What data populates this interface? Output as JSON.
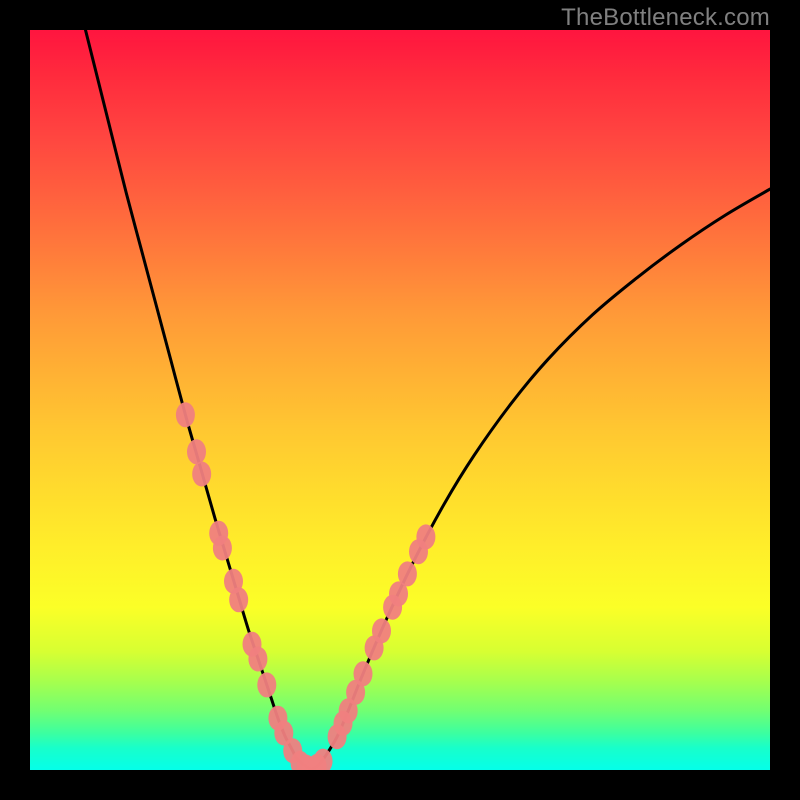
{
  "watermark": "TheBottleneck.com",
  "chart_data": {
    "type": "line",
    "title": "",
    "xlabel": "",
    "ylabel": "",
    "xlim": [
      0,
      100
    ],
    "ylim": [
      0,
      100
    ],
    "grid": false,
    "legend": false,
    "background": {
      "type": "vertical-gradient",
      "top": "#ff153f",
      "bottom": "#05ffe9",
      "note": "red-orange-yellow-green-cyan gradient"
    },
    "series": [
      {
        "name": "bottleneck-curve",
        "stroke": "#000000",
        "stroke_width": 3,
        "x": [
          7.5,
          9,
          11,
          13,
          15,
          17,
          19,
          21,
          23,
          25,
          26.5,
          28,
          29.5,
          31,
          32.5,
          33.5,
          34.5,
          35.5,
          36,
          37,
          38,
          39,
          40,
          41.5,
          43,
          45,
          48,
          52,
          56,
          60,
          65,
          70,
          76,
          82,
          88,
          94,
          100
        ],
        "y": [
          100,
          94,
          86,
          78,
          70.5,
          63,
          55.5,
          48,
          41,
          34,
          29,
          24,
          19,
          14.5,
          10,
          7,
          4.5,
          2.6,
          1.6,
          0.7,
          0.15,
          0.7,
          2,
          4.5,
          8,
          13,
          20,
          28.5,
          36,
          42.5,
          49.5,
          55.5,
          61.5,
          66.5,
          71,
          75,
          78.5
        ]
      },
      {
        "name": "data-marker-cluster-left",
        "type": "scatter",
        "fill": "#f08080",
        "stroke": "#933a3a",
        "r": 10,
        "x": [
          21.0,
          22.5,
          23.2,
          25.5,
          26.0,
          27.5,
          28.2,
          30.0,
          30.8,
          32.0,
          33.5,
          34.3,
          35.5
        ],
        "y": [
          48.0,
          43.0,
          40.0,
          32.0,
          30.0,
          25.5,
          23.0,
          17.0,
          15.0,
          11.5,
          7.0,
          5.0,
          2.6
        ]
      },
      {
        "name": "data-marker-cluster-bottom",
        "type": "scatter",
        "fill": "#f08080",
        "stroke": "#933a3a",
        "r": 10,
        "x": [
          36.5,
          37.3,
          38.0,
          38.8,
          39.6
        ],
        "y": [
          0.9,
          0.4,
          0.15,
          0.5,
          1.2
        ]
      },
      {
        "name": "data-marker-cluster-right",
        "type": "scatter",
        "fill": "#f08080",
        "stroke": "#933a3a",
        "r": 10,
        "x": [
          41.5,
          42.3,
          43.0,
          44.0,
          45.0,
          46.5,
          47.5,
          49.0,
          49.8,
          51.0,
          52.5,
          53.5
        ],
        "y": [
          4.5,
          6.3,
          8.0,
          10.5,
          13.0,
          16.5,
          18.8,
          22.0,
          23.8,
          26.5,
          29.5,
          31.5
        ]
      }
    ]
  }
}
